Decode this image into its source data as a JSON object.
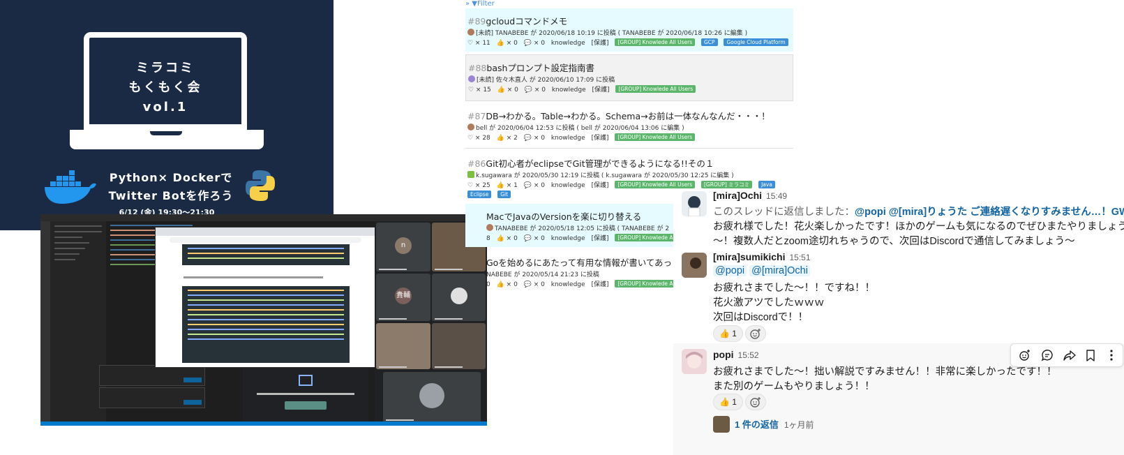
{
  "banner": {
    "title": "ミラコミ\nもくもく会\nvol.1",
    "subtitle": "Python× Dockerで\nTwitter Botを作ろう",
    "date": "6/12 (金) 19:30〜21:30"
  },
  "meet": {
    "avatar_n": "n",
    "avatar_k": "貴輔"
  },
  "list": {
    "filter_label": "» ▼Filter",
    "posts": [
      {
        "num": "#89",
        "title": "gcloudコマンドメモ",
        "meta": "[未読] TANABEBE が 2020/06/18 10:19 に投稿 ( TANABEBE が 2020/06/18 10:26 に編集 )",
        "likes": "♡ × 11",
        "good": "👍 × 0",
        "comments": "💬 × 0",
        "space": "knowledge",
        "scope": "[保護]",
        "tag_group": "[GROUP] Knowlede All Users",
        "tags": [
          "GCP",
          "Google Cloud Platform"
        ]
      },
      {
        "num": "#88",
        "title": "bashプロンプト設定指南書",
        "meta": "[未読] 佐々木直人 が 2020/06/10 17:09 に投稿",
        "likes": "♡ × 15",
        "good": "👍 × 0",
        "comments": "💬 × 0",
        "space": "knowledge",
        "scope": "[保護]",
        "tag_group": "[GROUP] Knowlede All Users"
      },
      {
        "num": "#87",
        "title": "DB→わかる。Table→わかる。Schema→お前は一体なんなんだ・・・！",
        "meta": "bell が 2020/06/04 12:53 に投稿 ( bell が 2020/06/04 13:06 に編集 )",
        "likes": "♡ × 28",
        "good": "👍 × 2",
        "comments": "💬 × 0",
        "space": "knowledge",
        "scope": "[保護]",
        "tag_group": "[GROUP] Knowlede All Users"
      },
      {
        "num": "#86",
        "title": "Git初心者がeclipseでGit管理ができるようになる!!その１",
        "meta": "k.sugawara が 2020/05/30 12:19 に投稿 ( k.sugawara が 2020/05/30 12:25 に編集 )",
        "likes": "♡ × 25",
        "good": "👍 × 1",
        "comments": "💬 × 0",
        "space": "knowledge",
        "scope": "[保護]",
        "tag_group": "[GROUP] Knowlede All Users",
        "tag_group2": "[GROUP] ミラコミ",
        "tags": [
          "Java",
          "Eclipse",
          "Git"
        ]
      },
      {
        "title": "MacでJavaのVersionを楽に切り替える",
        "meta": "TANABEBE が 2020/05/18 12:05 に投稿 ( TANABEBE が 2",
        "likes": "8",
        "good": "👍 × 0",
        "comments": "💬 × 0",
        "space": "knowledge",
        "scope": "[保護]",
        "tag_group": "[GROUP] Knowlede All Users"
      },
      {
        "title": "Goを始めるにあたって有用な情報が書いてあっ",
        "meta": "NABEBE が 2020/05/14 21:23 に投稿",
        "likes": "0",
        "good": "👍 × 0",
        "comments": "💬 × 0",
        "space": "knowledge",
        "scope": "[保護]",
        "tag_group": "[GROUP] Knowlede All Users"
      }
    ]
  },
  "slack": {
    "messages": [
      {
        "user": "[mira]Ochi",
        "time": "15:49",
        "reply_prefix": "このスレッドに返信しました：",
        "reply_link": "@popi @[mira]りょうた ご連絡遅くなりすみません…！GW…",
        "lines": [
          "お疲れ様でした！花火楽しかったです！ほかのゲームも気になるのでぜひまたやりましょう",
          "〜！複数人だとzoom途切れちゃうので、次回はDiscordで通信してみましょう〜"
        ]
      },
      {
        "user": "[mira]sumikichi",
        "time": "15:51",
        "mentions": [
          "@popi",
          "@[mira]Ochi"
        ],
        "lines": [
          "お疲れさまでした〜！！ですね！！",
          "花火激アツでしたｗｗｗ",
          "次回はDiscordで！！"
        ],
        "reaction": "👍 1"
      },
      {
        "user": "popi",
        "time": "15:52",
        "lines": [
          "お疲れさまでした〜！拙い解説ですみません！！非常に楽しかったです！！",
          "また別のゲームもやりましょう！！"
        ],
        "reaction": "👍 1",
        "thread_count": "1 件の返信",
        "thread_ago": "1ヶ月前"
      }
    ]
  },
  "colors": {
    "banner_bg": "#1b2a44",
    "slack_link": "#1264a3",
    "tag_green": "#5bb56b",
    "tag_blue": "#3a8fd8"
  }
}
